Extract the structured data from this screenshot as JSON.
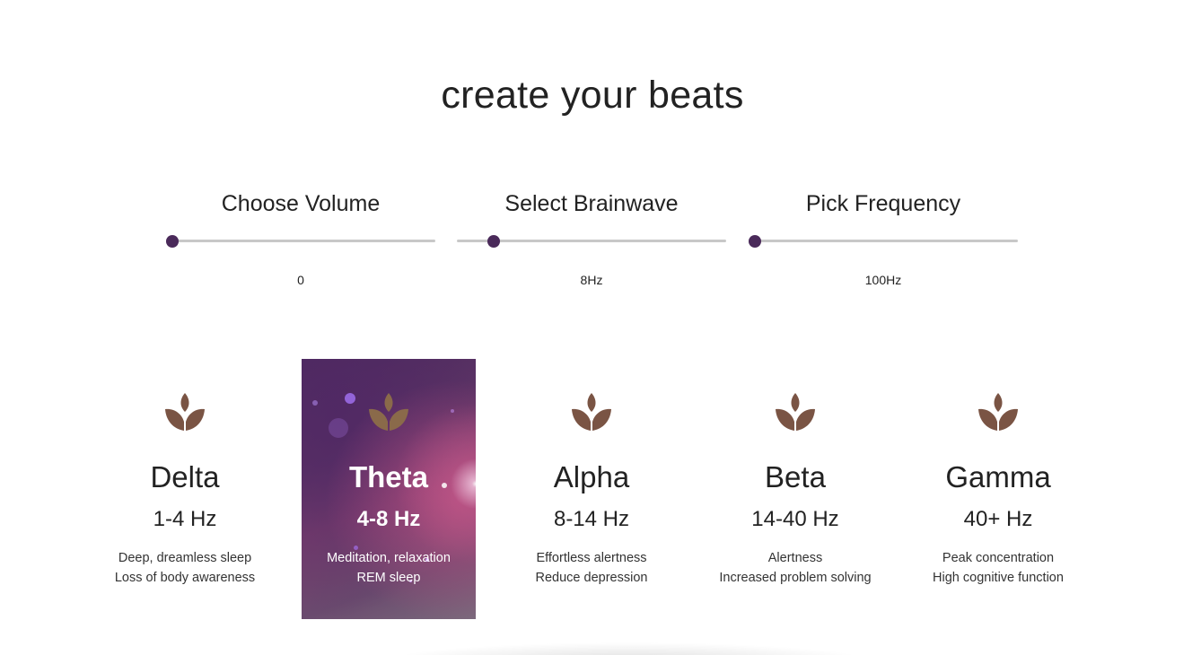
{
  "page": {
    "title": "create your beats"
  },
  "controls": [
    {
      "label": "Choose Volume",
      "value": "0",
      "level": 0.0
    },
    {
      "label": "Select Brainwave",
      "value": "8Hz",
      "level": 0.14
    },
    {
      "label": "Pick Frequency",
      "value": "100Hz",
      "level": 0.02
    }
  ],
  "cards": [
    {
      "name": "Delta",
      "range": "1-4 Hz",
      "desc1": "Deep, dreamless sleep",
      "desc2": "Loss of body awareness",
      "active": false
    },
    {
      "name": "Theta",
      "range": "4-8 Hz",
      "desc1": "Meditation, relaxation",
      "desc2": "REM sleep",
      "active": true
    },
    {
      "name": "Alpha",
      "range": "8-14 Hz",
      "desc1": "Effortless alertness",
      "desc2": "Reduce depression",
      "active": false
    },
    {
      "name": "Beta",
      "range": "14-40 Hz",
      "desc1": "Alertness",
      "desc2": "Increased problem solving",
      "active": false
    },
    {
      "name": "Gamma",
      "range": "40+ Hz",
      "desc1": "Peak concentration",
      "desc2": "High cognitive function",
      "active": false
    }
  ],
  "icons": {
    "card_icon": "lotus-icon"
  },
  "colors": {
    "accent": "#4a2a5a",
    "track": "#c8c8c8",
    "lotus": "#7a5444",
    "lotus_active": "#8a6a4a",
    "text": "#222222"
  }
}
